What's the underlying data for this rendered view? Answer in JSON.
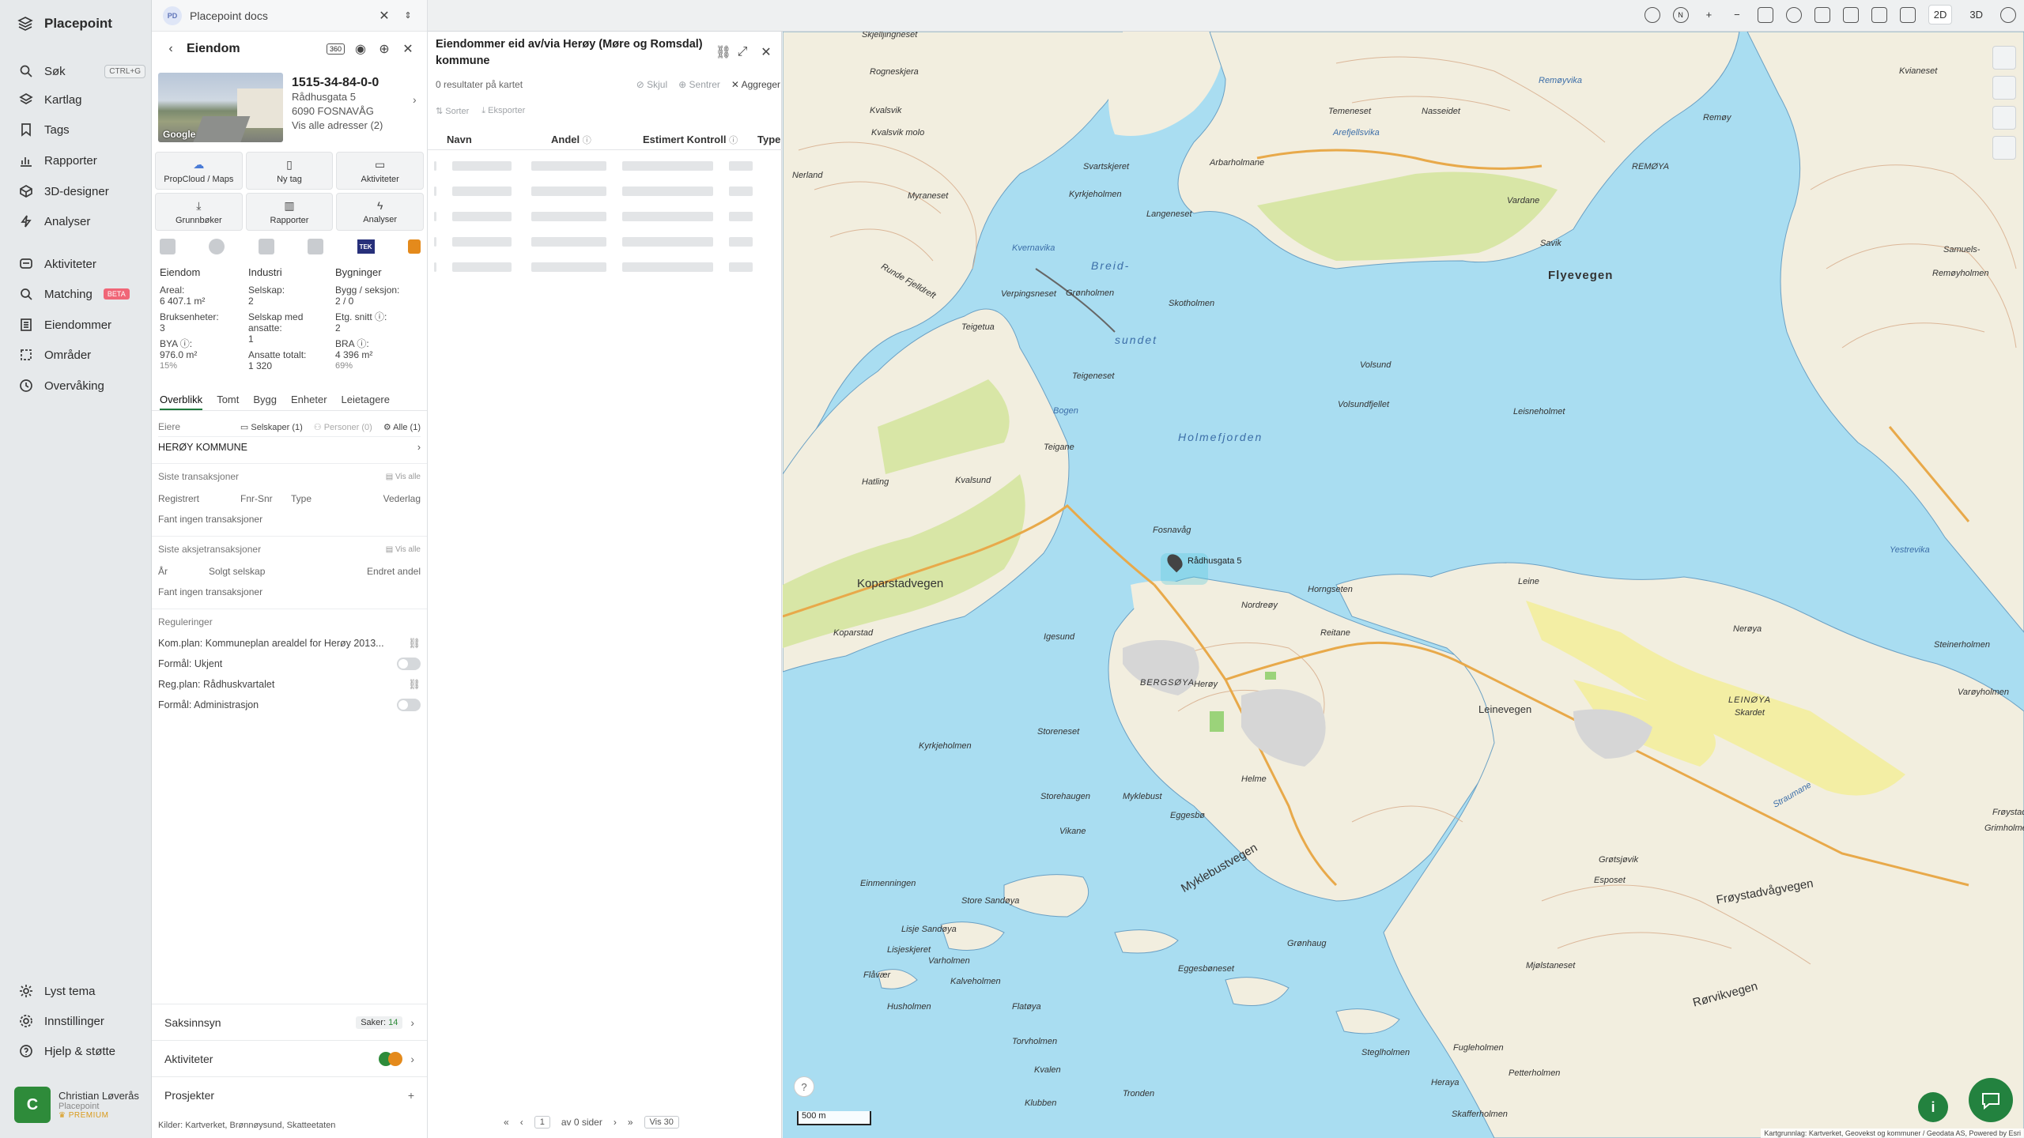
{
  "app": {
    "name": "Placepoint"
  },
  "nav": {
    "search": "Søk",
    "search_kbd": "CTRL+G",
    "items": [
      "Kartlag",
      "Tags",
      "Rapporter",
      "3D-designer",
      "Analyser",
      "Aktiviteter",
      "Matching",
      "Eiendommer",
      "Områder",
      "Overvåking"
    ],
    "beta": "BETA",
    "bottom": [
      "Lyst tema",
      "Innstillinger",
      "Hjelp & støtte"
    ],
    "user": {
      "initial": "C",
      "name": "Christian Løverås",
      "org": "Placepoint",
      "plan": "PREMIUM"
    }
  },
  "doc": {
    "badge": "PD",
    "title": "Placepoint docs"
  },
  "property": {
    "header": "Eiendom",
    "header_badge": "360",
    "photo_credit": "Google",
    "id": "1515-34-84-0-0",
    "street": "Rådhusgata 5",
    "city": "6090 FOSNAVÅG",
    "all_addresses": "Vis alle adresser (2)",
    "buttons": [
      "PropCloud / Maps",
      "Ny tag",
      "Aktiviteter",
      "Grunnbøker",
      "Rapporter",
      "Analyser"
    ],
    "tek_badge": "TEK",
    "stats": {
      "col1_title": "Eiendom",
      "col2_title": "Industri",
      "col3_title": "Bygninger",
      "areal_label": "Areal:",
      "areal_value": "6 407.1 m²",
      "bruksenheter_label": "Bruksenheter:",
      "bruksenheter_value": "3",
      "bya_label": "BYA ⓘ:",
      "bya_value": "976.0 m²",
      "bya_pct": "15%",
      "selskap_label": "Selskap:",
      "selskap_value": "2",
      "selskap_ansatte_label": "Selskap med ansatte:",
      "selskap_ansatte_value": "1",
      "ansatte_label": "Ansatte totalt:",
      "ansatte_value": "1 320",
      "bygg_label": "Bygg / seksjon:",
      "bygg_value": "2 / 0",
      "etg_label": "Etg. snitt ⓘ:",
      "etg_value": "2",
      "bra_label": "BRA ⓘ:",
      "bra_value": "4 396 m²",
      "bra_pct": "69%"
    },
    "tabs": [
      "Overblikk",
      "Tomt",
      "Bygg",
      "Enheter",
      "Leietagere"
    ],
    "owners": {
      "label": "Eiere",
      "companies": "Selskaper (1)",
      "persons": "Personer (0)",
      "all": "Alle (1)",
      "owner": "HERØY KOMMUNE"
    },
    "transactions": {
      "title": "Siste transaksjoner",
      "show_all": "Vis alle",
      "cols": [
        "Registrert",
        "Fnr-Snr",
        "Type",
        "Vederlag"
      ],
      "empty": "Fant ingen transaksjoner"
    },
    "stock": {
      "title": "Siste aksjetransaksjoner",
      "show_all": "Vis alle",
      "cols": [
        "År",
        "Solgt selskap",
        "Endret andel"
      ],
      "empty": "Fant ingen transaksjoner"
    },
    "regulations": {
      "title": "Reguleringer",
      "komplan": "Kom.plan: Kommuneplan arealdel for Herøy 2013...",
      "formal1": "Formål: Ukjent",
      "regplan": "Reg.plan: Rådhuskvartalet",
      "formal2": "Formål: Administrasjon"
    },
    "saksinnsyn": "Saksinnsyn",
    "saker_label": "Saker:",
    "saker_count": "14",
    "aktiviteter": "Aktiviteter",
    "prosjekter": "Prosjekter",
    "sources_label": "Kilder:",
    "sources": [
      "Kartverket,",
      "Brønnøysund,",
      "Skatteetaten"
    ]
  },
  "results": {
    "title": "Eiendommer eid av/via Herøy (Møre og Romsdal) kommune",
    "count": "0 resultater på kartet",
    "skjul": "Skjul",
    "sentrer": "Sentrer",
    "aggreger": "Aggreger",
    "sorter": "Sorter",
    "eksporter": "Eksporter",
    "cols": [
      "Navn",
      "Andel",
      "Estimert Kontroll",
      "Type"
    ],
    "pager": {
      "page": "1",
      "of": "av 0 sider",
      "per_page": "Vis 30"
    }
  },
  "map": {
    "mode_2d": "2D",
    "mode_3d": "3D",
    "scale": "500 m",
    "attribution": "Kartgrunnlag: Kartverket, Geovekst og kommuner / Geodata AS, Powered by Esri",
    "pin_label": "Rådhusgata 5",
    "labels": [
      "Skjelljingneset",
      "Rogneskjera",
      "Kvalsvik",
      "Kvalsvik molo",
      "Nerland",
      "Myraneset",
      "Svartskjeret",
      "Kyrkjeholmen",
      "Langeneset",
      "Temeneset",
      "Arefjellsvika",
      "Arbarholmane",
      "Nasseidet",
      "Remøyvika",
      "Kvianeset",
      "Remøy",
      "REMØYA",
      "Vardane",
      "Savik",
      "Flyevegen",
      "Runde Fjelldreft",
      "Kvernavika",
      "Breid-",
      "sundet",
      "Verpingsneset",
      "Grønholmen",
      "Skotholmen",
      "Teigetua",
      "Teigeneset",
      "Bogen",
      "Holmefjorden",
      "Teigane",
      "Kvalsund",
      "Hatling",
      "Volsund",
      "Volsundfjellet",
      "Leisneholmet",
      "Koparstadvegen",
      "Koparstad",
      "Igesund",
      "Fosnavåg",
      "BERGSØYA",
      "Herøy",
      "Nordreøy",
      "Horngseten",
      "Reitane",
      "Leine",
      "Leinevegen",
      "LEINØYA",
      "Kyrkjeholmen",
      "Storeneset",
      "Storehaugen",
      "Vikane",
      "Myklebust",
      "Eggesbø",
      "Myklebustvegen",
      "Helme",
      "Grønhaug",
      "Einmenningen",
      "Store Sandøya",
      "Lisje Sandøya",
      "Lisjeskjeret",
      "Varholmen",
      "Flåvær",
      "Kalveholmen",
      "Husholmen",
      "Flatøya",
      "Torvholmen",
      "Kvalen",
      "Klubben",
      "Tronden",
      "Fugleholmen",
      "Petterholmen",
      "Heraya",
      "Skafferholmen",
      "Steglholmen",
      "Eggesbøneset",
      "Mjølstaneset",
      "Rørvikvegen",
      "Frøystadvågvegen",
      "Esposet",
      "Grøtsjøvik",
      "Frøystad",
      "Grimholmen",
      "Samuels-",
      "Remøyholmen",
      "Nerøya",
      "Steinerholmen",
      "Varøyholmen",
      "Yestrevika",
      "Straumane",
      "Skardet"
    ],
    "water_labels": [
      "Holmefjorden",
      "Breid-",
      "sundet",
      "Bogen",
      "Remøyvika",
      "Straumane"
    ]
  }
}
